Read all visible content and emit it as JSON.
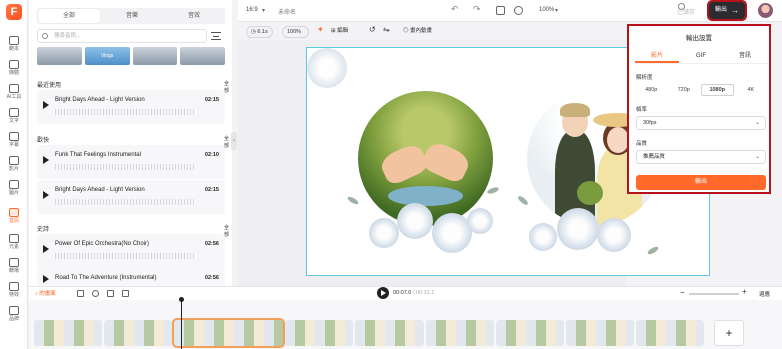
{
  "app": {
    "logo": "F"
  },
  "rail": [
    {
      "label": "範本",
      "icon": "template-icon"
    },
    {
      "label": "媒體",
      "icon": "media-icon"
    },
    {
      "label": "AI工具",
      "icon": "ai-tools-icon"
    },
    {
      "label": "文字",
      "icon": "text-icon"
    },
    {
      "label": "字幕",
      "icon": "subtitle-icon"
    },
    {
      "label": "影片",
      "icon": "video-icon"
    },
    {
      "label": "圖片",
      "icon": "image-icon"
    },
    {
      "label": "音訊",
      "icon": "audio-icon",
      "active": true
    },
    {
      "label": "元素",
      "icon": "elements-icon"
    },
    {
      "label": "轉場",
      "icon": "transition-icon"
    },
    {
      "label": "特效",
      "icon": "effects-icon"
    },
    {
      "label": "品牌",
      "icon": "brand-icon"
    }
  ],
  "panel": {
    "tabs": [
      "全部",
      "音樂",
      "音效"
    ],
    "search_placeholder": "搜尋音訊...",
    "thumb_label": "Vlogs",
    "sections": [
      {
        "title": "最近使用",
        "see_all": "全部",
        "tracks": [
          {
            "name": "Bright Days Ahead - Light Version",
            "duration": "02:15"
          }
        ]
      },
      {
        "title": "歡快",
        "see_all": "全部",
        "tracks": [
          {
            "name": "Funk That Feelings Instrumental",
            "duration": "02:10"
          },
          {
            "name": "Bright Days Ahead - Light Version",
            "duration": "02:15"
          }
        ]
      },
      {
        "title": "史詩",
        "see_all": "全部",
        "tracks": [
          {
            "name": "Power Of Epic Orchestra(No Choir)",
            "duration": "02:56"
          },
          {
            "name": "Road To The Adventure (Instrumental)",
            "duration": "02:56"
          }
        ]
      }
    ]
  },
  "topbar": {
    "ratio": "16:9",
    "project_name": "未命名",
    "zoom": "100%",
    "saved_status": "已儲存",
    "export_label": "輸出"
  },
  "subbar": {
    "duration": "6.1s",
    "scale": "100%",
    "edit_label": "編輯",
    "animation_label": "畫內動畫"
  },
  "export_dialog": {
    "title": "輸出設置",
    "tabs": [
      "影片",
      "GIF",
      "音訊"
    ],
    "resolution_label": "解析度",
    "resolutions": [
      "480p",
      "720p",
      "1080p",
      "4K"
    ],
    "selected_resolution": "1080p",
    "fps_label": "幀率",
    "fps_value": "30fps",
    "quality_label": "品質",
    "quality_value": "推薦品質",
    "export_button": "輸出"
  },
  "playbar": {
    "music_badge": "的畫面",
    "current_time": "00:07.0",
    "total_time": "00:31.1",
    "fit_label": "適應"
  },
  "colors": {
    "accent": "#ff6a2b",
    "highlight_border": "#b5121b",
    "canvas_border": "#5ccbe0"
  }
}
